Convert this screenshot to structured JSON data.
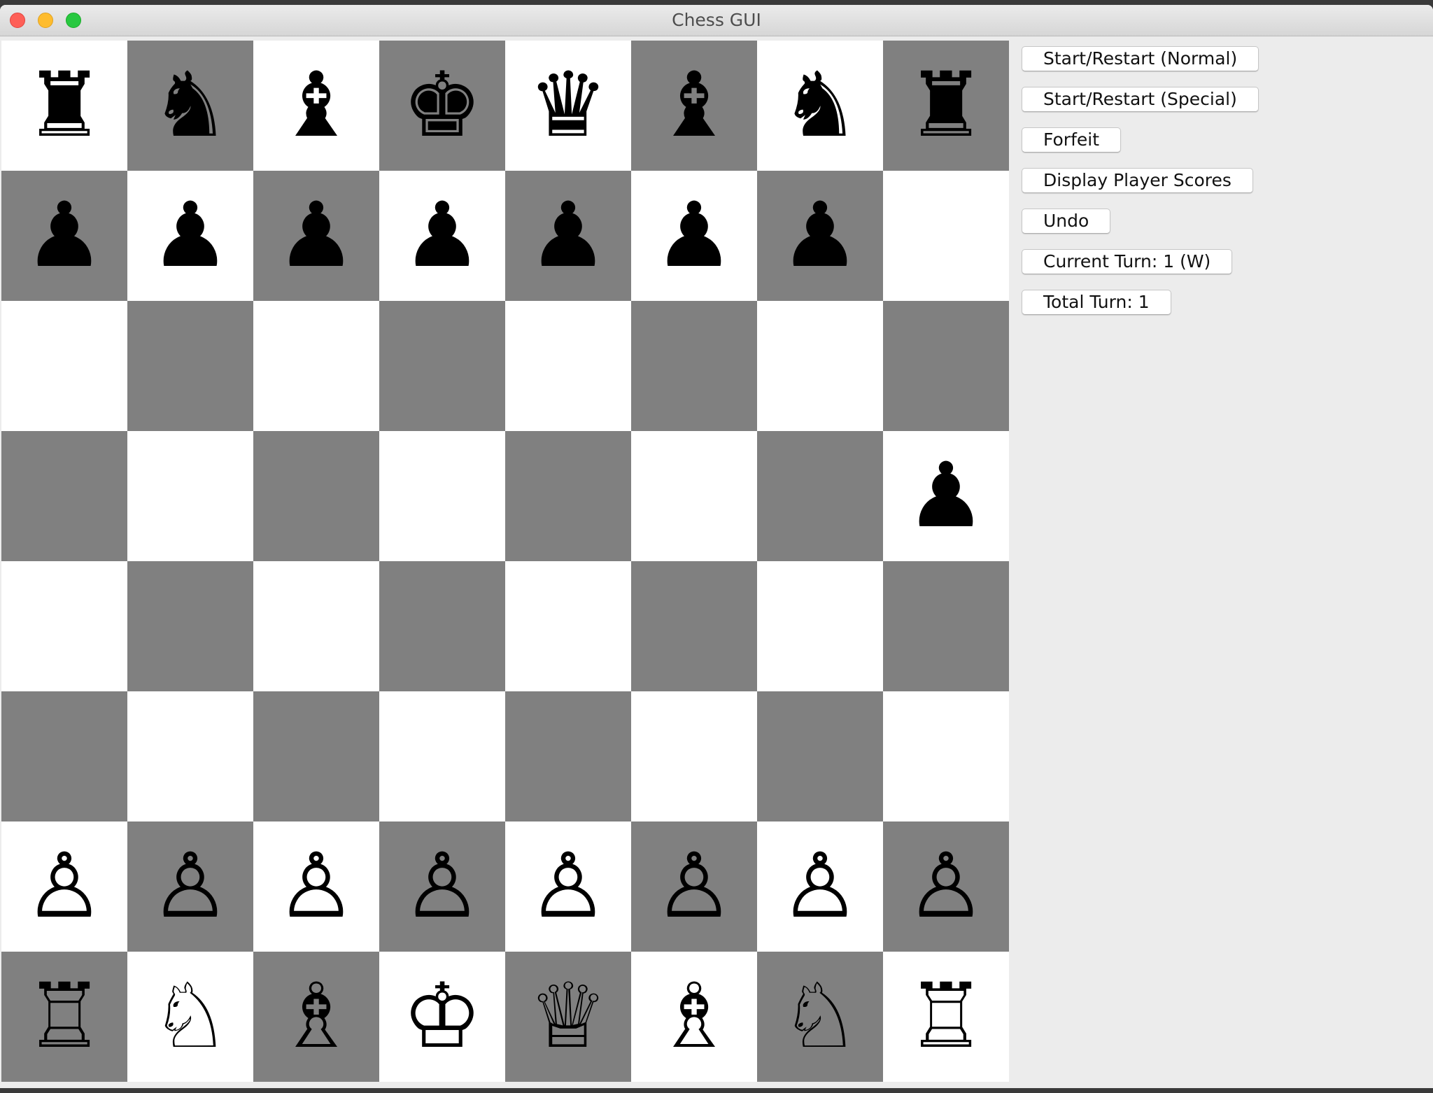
{
  "window": {
    "title": "Chess GUI"
  },
  "board": {
    "rows": [
      [
        {
          "piece": "rook",
          "color": "black",
          "glyph": "♜"
        },
        {
          "piece": "knight",
          "color": "black",
          "glyph": "♞"
        },
        {
          "piece": "bishop",
          "color": "black",
          "glyph": "♝"
        },
        {
          "piece": "king",
          "color": "black",
          "glyph": "♚"
        },
        {
          "piece": "queen",
          "color": "black",
          "glyph": "♛"
        },
        {
          "piece": "bishop",
          "color": "black",
          "glyph": "♝"
        },
        {
          "piece": "knight",
          "color": "black",
          "glyph": "♞"
        },
        {
          "piece": "rook",
          "color": "black",
          "glyph": "♜"
        }
      ],
      [
        {
          "piece": "pawn",
          "color": "black",
          "glyph": "♟"
        },
        {
          "piece": "pawn",
          "color": "black",
          "glyph": "♟"
        },
        {
          "piece": "pawn",
          "color": "black",
          "glyph": "♟"
        },
        {
          "piece": "pawn",
          "color": "black",
          "glyph": "♟"
        },
        {
          "piece": "pawn",
          "color": "black",
          "glyph": "♟"
        },
        {
          "piece": "pawn",
          "color": "black",
          "glyph": "♟"
        },
        {
          "piece": "pawn",
          "color": "black",
          "glyph": "♟"
        },
        null
      ],
      [
        null,
        null,
        null,
        null,
        null,
        null,
        null,
        null
      ],
      [
        null,
        null,
        null,
        null,
        null,
        null,
        null,
        {
          "piece": "pawn",
          "color": "black",
          "glyph": "♟"
        }
      ],
      [
        null,
        null,
        null,
        null,
        null,
        null,
        null,
        null
      ],
      [
        null,
        null,
        null,
        null,
        null,
        null,
        null,
        null
      ],
      [
        {
          "piece": "pawn",
          "color": "white",
          "glyph": "♙"
        },
        {
          "piece": "pawn",
          "color": "white",
          "glyph": "♙"
        },
        {
          "piece": "pawn",
          "color": "white",
          "glyph": "♙"
        },
        {
          "piece": "pawn",
          "color": "white",
          "glyph": "♙"
        },
        {
          "piece": "pawn",
          "color": "white",
          "glyph": "♙"
        },
        {
          "piece": "pawn",
          "color": "white",
          "glyph": "♙"
        },
        {
          "piece": "pawn",
          "color": "white",
          "glyph": "♙"
        },
        {
          "piece": "pawn",
          "color": "white",
          "glyph": "♙"
        }
      ],
      [
        {
          "piece": "rook",
          "color": "white",
          "glyph": "♖"
        },
        {
          "piece": "knight",
          "color": "white",
          "glyph": "♘"
        },
        {
          "piece": "bishop",
          "color": "white",
          "glyph": "♗"
        },
        {
          "piece": "king",
          "color": "white",
          "glyph": "♔"
        },
        {
          "piece": "queen",
          "color": "white",
          "glyph": "♕"
        },
        {
          "piece": "bishop",
          "color": "white",
          "glyph": "♗"
        },
        {
          "piece": "knight",
          "color": "white",
          "glyph": "♘"
        },
        {
          "piece": "rook",
          "color": "white",
          "glyph": "♖"
        }
      ]
    ],
    "light_color": "#ffffff",
    "dark_color": "#808080"
  },
  "controls": {
    "start_normal": "Start/Restart (Normal)",
    "start_special": "Start/Restart (Special)",
    "forfeit": "Forfeit",
    "display_scores": "Display Player Scores",
    "undo": "Undo",
    "current_turn": "Current Turn: 1 (W)",
    "total_turn": "Total Turn: 1"
  }
}
